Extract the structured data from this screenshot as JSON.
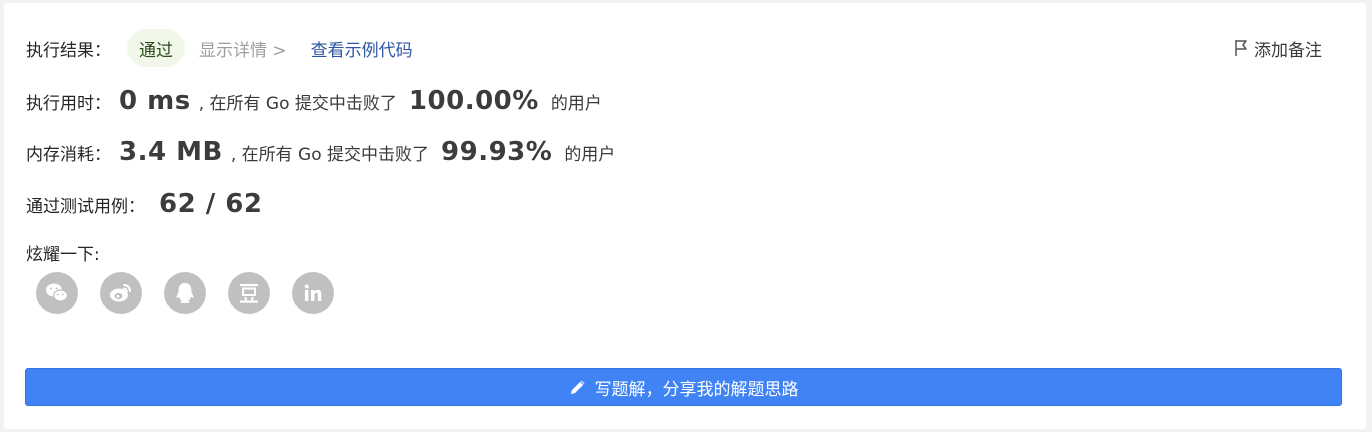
{
  "result": {
    "label": "执行结果：",
    "status": "通过",
    "details_link": "显示详情 >",
    "example_link": "查看示例代码"
  },
  "note_button": "添加备注",
  "runtime": {
    "label": "执行用时：",
    "value": "0 ms",
    "mid_text": ", 在所有 Go 提交中击败了",
    "percent": "100.00%",
    "suffix": "的用户"
  },
  "memory": {
    "label": "内存消耗：",
    "value": "3.4 MB",
    "mid_text": ", 在所有 Go 提交中击败了",
    "percent": "99.93%",
    "suffix": "的用户"
  },
  "tests": {
    "label": "通过测试用例：",
    "value": "62 / 62"
  },
  "share": {
    "label": "炫耀一下:",
    "icons": [
      "wechat-icon",
      "weibo-icon",
      "qq-icon",
      "douban-icon",
      "linkedin-icon"
    ]
  },
  "write_solution_button": "写题解，分享我的解题思路",
  "colors": {
    "accent": "#3f83f5",
    "pass_bg": "#f1f8e9",
    "link": "#2f55a4"
  }
}
